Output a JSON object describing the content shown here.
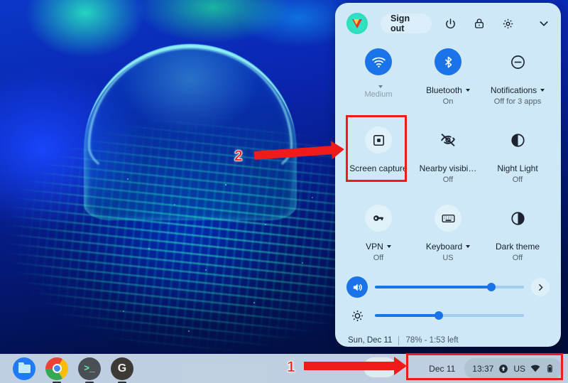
{
  "panel": {
    "header": {
      "avatar_name": "user-avatar",
      "sign_out_label": "Sign out",
      "power_icon": "power-icon",
      "lock_icon": "lock-icon",
      "settings_icon": "gear-icon",
      "collapse_icon": "chevron-down-icon"
    },
    "tiles": [
      {
        "id": "network",
        "icon": "wifi-icon",
        "label": "",
        "sub": "Medium",
        "state": "on",
        "has_caret": true,
        "faded_label": true
      },
      {
        "id": "bluetooth",
        "icon": "bluetooth-icon",
        "label": "Bluetooth",
        "sub": "On",
        "state": "on",
        "has_caret": true,
        "faded_label": false
      },
      {
        "id": "notifications",
        "icon": "do-not-disturb-icon",
        "label": "Notifications",
        "sub": "Off for 3 apps",
        "state": "plain",
        "has_caret": true,
        "faded_label": false
      },
      {
        "id": "screen-capture",
        "icon": "screen-capture-icon",
        "label": "Screen capture",
        "sub": "",
        "state": "off",
        "has_caret": false,
        "faded_label": false
      },
      {
        "id": "nearby-visibility",
        "icon": "eye-off-icon",
        "label": "Nearby visibi…",
        "sub": "Off",
        "state": "plain",
        "has_caret": false,
        "faded_label": false
      },
      {
        "id": "night-light",
        "icon": "night-light-icon",
        "label": "Night Light",
        "sub": "Off",
        "state": "plain",
        "has_caret": false,
        "faded_label": false
      },
      {
        "id": "vpn",
        "icon": "key-icon",
        "label": "VPN",
        "sub": "Off",
        "state": "off",
        "has_caret": true,
        "faded_label": false
      },
      {
        "id": "keyboard",
        "icon": "keyboard-icon",
        "label": "Keyboard",
        "sub": "US",
        "state": "off",
        "has_caret": true,
        "faded_label": false
      },
      {
        "id": "dark-theme",
        "icon": "dark-theme-icon",
        "label": "Dark theme",
        "sub": "Off",
        "state": "plain",
        "has_caret": false,
        "faded_label": false
      }
    ],
    "sliders": {
      "volume": {
        "icon": "volume-icon",
        "value": 78
      },
      "brightness": {
        "icon": "brightness-icon",
        "value": 43
      },
      "expand_icon": "chevron-right-icon"
    },
    "footer": {
      "date": "Sun, Dec 11",
      "battery": "78% - 1:53 left"
    }
  },
  "shelf": {
    "apps": [
      {
        "id": "files",
        "icon": "files-icon",
        "glyph": "",
        "running": false
      },
      {
        "id": "chrome",
        "icon": "chrome-icon",
        "glyph": "",
        "running": true
      },
      {
        "id": "terminal",
        "icon": "terminal-icon",
        "glyph": ">_",
        "running": true
      },
      {
        "id": "gmail",
        "icon": "g-icon",
        "glyph": "G",
        "running": true
      }
    ]
  },
  "tray": {
    "date": "Dec 11",
    "time": "13:37",
    "update_icon": "update-available-icon",
    "keyboard_layout": "US",
    "wifi_icon": "wifi-icon",
    "battery_icon": "battery-icon"
  },
  "annotations": {
    "marker_one": "1",
    "marker_two": "2"
  },
  "colors": {
    "accent": "#1a73e8",
    "panel_bg": "#cfe8f7",
    "annotation_red": "#ef1b1b",
    "shelf_bg": "#cddeea"
  }
}
